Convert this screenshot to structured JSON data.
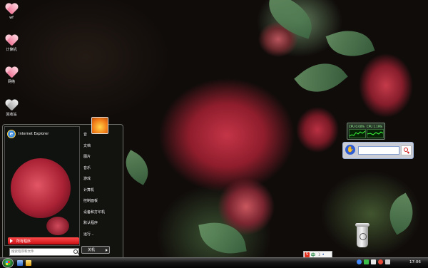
{
  "desktop_icons": [
    {
      "label": "wf",
      "icon": "heart-icon"
    },
    {
      "label": "计算机",
      "icon": "heart-icon"
    },
    {
      "label": "网络",
      "icon": "heart-icon"
    },
    {
      "label": "回收站",
      "icon": "recycle-heart-icon"
    }
  ],
  "start_menu": {
    "pinned": {
      "label": "Internet Explorer",
      "icon": "ie-icon"
    },
    "right_items": [
      "音",
      "文档",
      "图片",
      "音乐",
      "游戏",
      "计算机",
      "控制面板",
      "设备和打印机",
      "默认程序",
      "运行..."
    ],
    "all_programs_label": "所有程序",
    "search_placeholder": "搜索程序和文件",
    "shutdown_label": "关机"
  },
  "gadgets": {
    "cpu": {
      "cpu_text": "CPU 0.00%",
      "mem_text": "CPU 1.19%"
    },
    "baidu": {
      "input_value": ""
    }
  },
  "language_bar": {
    "zh_label": "中"
  },
  "taskbar": {
    "clock": "17:06"
  },
  "colors": {
    "accent_red": "#c80f14",
    "taskbar": "#151515"
  }
}
